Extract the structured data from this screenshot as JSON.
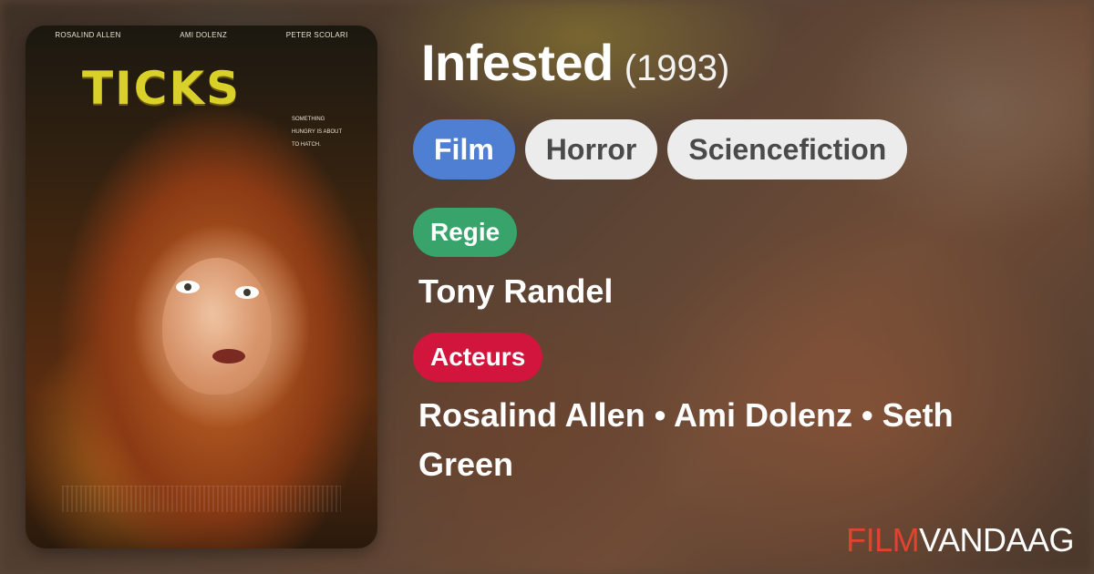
{
  "poster": {
    "credits": [
      "Rosalind Allen",
      "Ami Dolenz",
      "Peter Scolari"
    ],
    "logo_text": "TICKS",
    "tagline": "SOMETHING HUNGRY IS ABOUT TO HATCH."
  },
  "movie": {
    "title": "Infested",
    "year": "(1993)"
  },
  "genres": [
    "Film",
    "Horror",
    "Sciencefiction"
  ],
  "director_label": "Regie",
  "director": "Tony Randel",
  "cast_label": "Acteurs",
  "cast": "Rosalind Allen • Ami Dolenz • Seth Green",
  "brand": {
    "part1": "FILM",
    "part2": "VANDAAG"
  },
  "colors": {
    "film_pill": "#4f7fd2",
    "genre_pill": "#ececec",
    "regie_badge": "#38a36a",
    "acteurs_badge": "#d2153c",
    "brand_red": "#e2432e"
  }
}
